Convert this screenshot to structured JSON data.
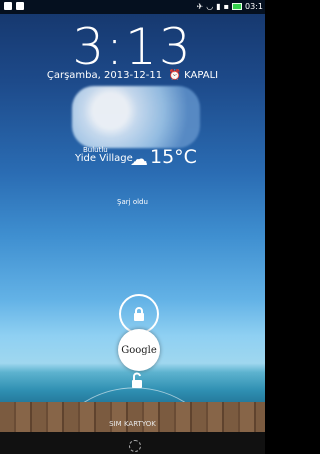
{
  "status_bar": {
    "time": "03:1",
    "icons": [
      "image-icon",
      "notification-icon",
      "airplane-icon",
      "wifi-icon",
      "signal-icon",
      "sd-icon",
      "battery-icon"
    ]
  },
  "lockscreen": {
    "clock": "3:13",
    "date": "Çarşamba, 2013-12-11",
    "alarm_label": "KAPALI",
    "weather": {
      "condition": "Bulutlu",
      "location": "Yide Village",
      "temperature": "15°C"
    },
    "charging_status": "Şarj oldu",
    "google_label": "Google",
    "sim_status": "SIM KARTYOK"
  },
  "colors": {
    "status_bar_bg": "#05101f",
    "battery": "#34d14b"
  }
}
